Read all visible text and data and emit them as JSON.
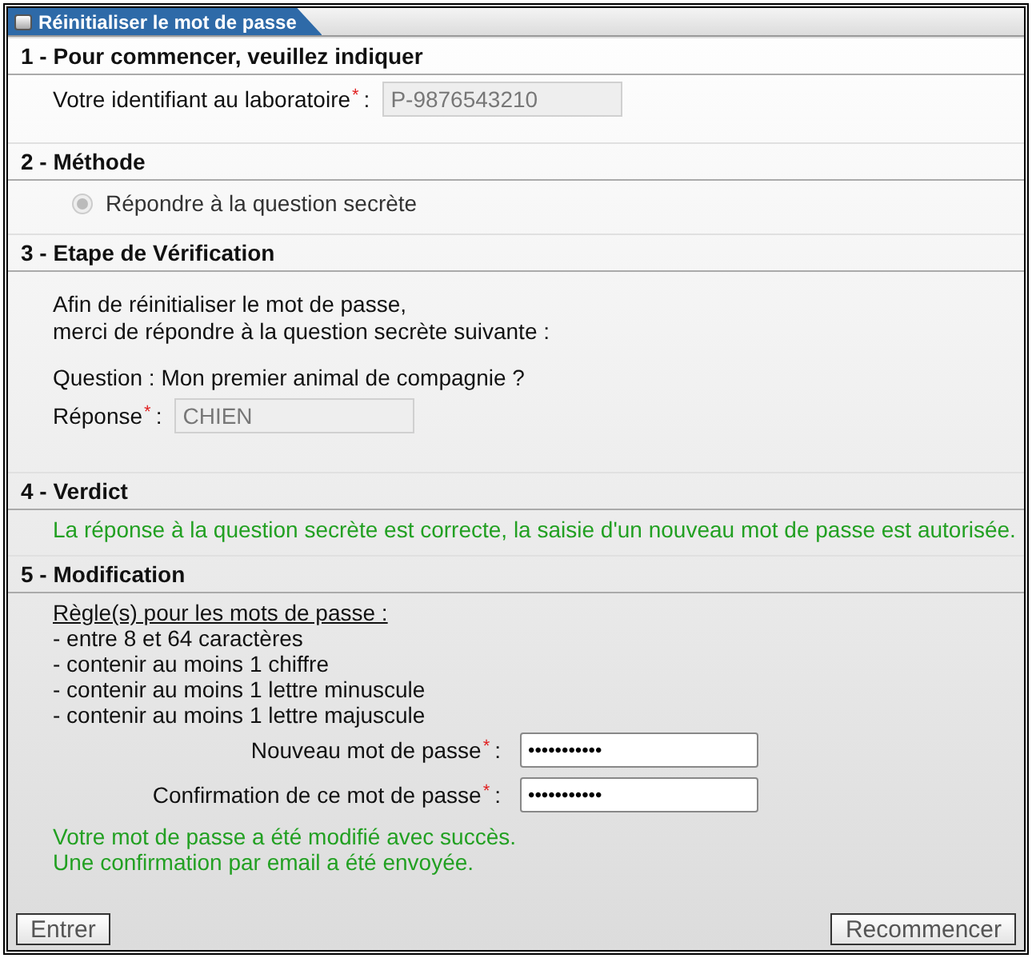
{
  "window": {
    "title": "Réinitialiser le mot de passe"
  },
  "sections": [
    {
      "title": "1 - Pour commencer, veuillez indiquer",
      "items": [
        {
          "kind": "field",
          "label": "Votre identifiant au laboratoire",
          "required_mark": "*",
          "separator": ":",
          "value": "P-9876543210",
          "disabled": true
        }
      ]
    },
    {
      "title": "2 - Méthode",
      "items": [
        {
          "kind": "radio",
          "label": "Répondre à la question secrète",
          "selected": true,
          "disabled": true
        }
      ]
    },
    {
      "title": "3 - Etape de Vérification",
      "items": [
        {
          "kind": "text",
          "lines": [
            "Afin de réinitialiser le mot de passe,",
            "merci de répondre à la question secrète suivante :"
          ]
        },
        {
          "kind": "text",
          "lines": [
            "Question : Mon premier animal de compagnie ?"
          ]
        },
        {
          "kind": "field",
          "label": "Réponse",
          "required_mark": "*",
          "separator": ":",
          "value": "CHIEN",
          "disabled": true
        }
      ]
    },
    {
      "title": "4 - Verdict",
      "items": [
        {
          "kind": "success",
          "lines": [
            "La réponse à la question secrète est correcte, la saisie d'un nouveau mot de passe est autorisée."
          ]
        }
      ]
    },
    {
      "title": "5 - Modification",
      "items": [
        {
          "kind": "rules",
          "heading": "Règle(s) pour les mots de passe :",
          "lines": [
            "- entre 8 et 64 caractères",
            "- contenir au moins 1 chiffre",
            "- contenir au moins 1 lettre minuscule",
            "- contenir au moins 1 lettre majuscule"
          ]
        },
        {
          "kind": "password",
          "label": "Nouveau mot de passe",
          "required_mark": "*",
          "separator": ":",
          "value": "•••••••••••",
          "disabled": false
        },
        {
          "kind": "password",
          "label": "Confirmation de ce mot de passe",
          "required_mark": "*",
          "separator": ":",
          "value": "•••••••••••",
          "disabled": false
        },
        {
          "kind": "success",
          "lines": [
            "Votre mot de passe a été modifié avec succès.",
            "Une confirmation par email a été envoyée."
          ]
        }
      ]
    }
  ],
  "buttons": [
    {
      "label": "Entrer"
    },
    {
      "label": "Recommencer"
    }
  ]
}
